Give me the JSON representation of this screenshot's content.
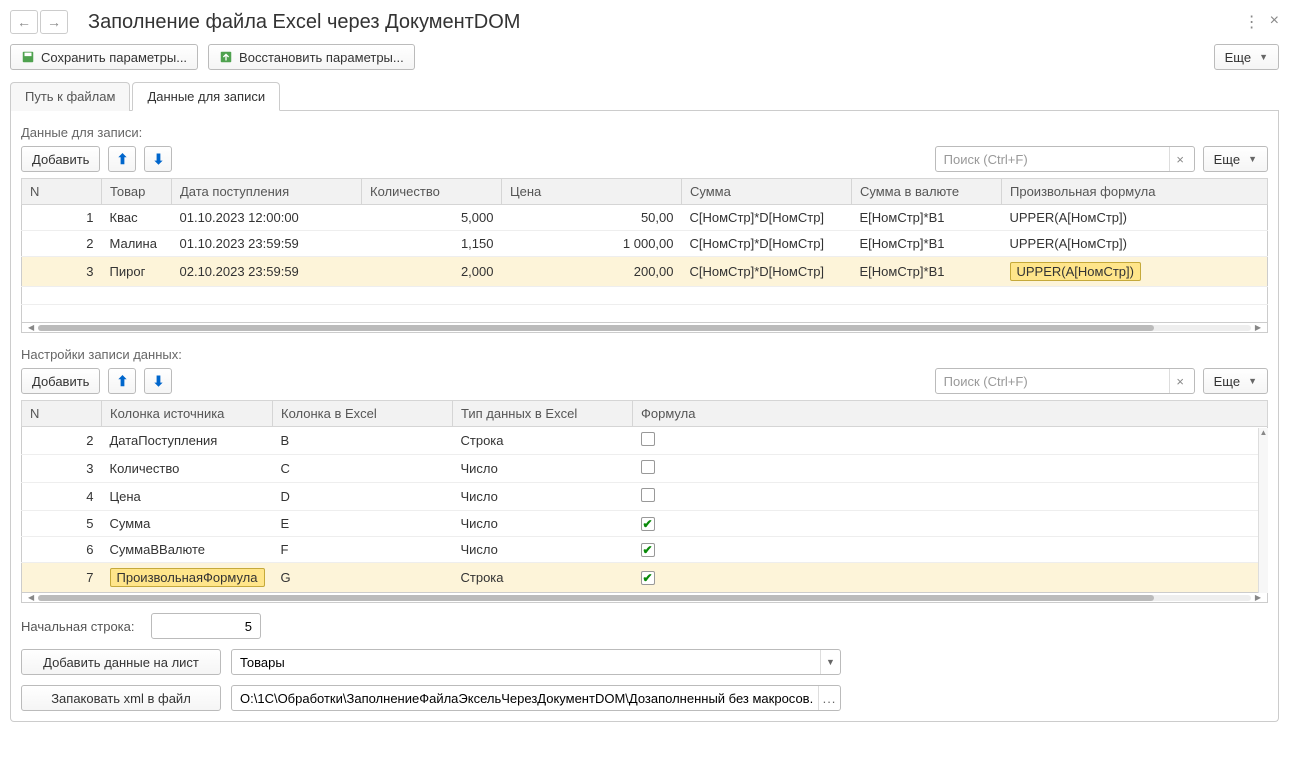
{
  "window": {
    "title": "Заполнение файла Excel через ДокументDOM"
  },
  "toolbar": {
    "save_params": "Сохранить параметры...",
    "restore_params": "Восстановить параметры...",
    "more": "Еще"
  },
  "tabs": {
    "path": "Путь к файлам",
    "data": "Данные для записи"
  },
  "data_section": {
    "label": "Данные для записи:",
    "add": "Добавить",
    "more": "Еще",
    "search_placeholder": "Поиск (Ctrl+F)",
    "columns": {
      "n": "N",
      "product": "Товар",
      "date": "Дата поступления",
      "qty": "Количество",
      "price": "Цена",
      "sum": "Сумма",
      "sum_cur": "Сумма в валюте",
      "formula": "Произвольная формула"
    },
    "rows": [
      {
        "n": "1",
        "product": "Квас",
        "date": "01.10.2023 12:00:00",
        "qty": "5,000",
        "price": "50,00",
        "sum": "C[НомСтр]*D[НомСтр]",
        "sum_cur": "E[НомСтр]*B1",
        "formula": "UPPER(A[НомСтр])"
      },
      {
        "n": "2",
        "product": "Малина",
        "date": "01.10.2023 23:59:59",
        "qty": "1,150",
        "price": "1 000,00",
        "sum": "C[НомСтр]*D[НомСтр]",
        "sum_cur": "E[НомСтр]*B1",
        "formula": "UPPER(A[НомСтр])"
      },
      {
        "n": "3",
        "product": "Пирог",
        "date": "02.10.2023 23:59:59",
        "qty": "2,000",
        "price": "200,00",
        "sum": "C[НомСтр]*D[НомСтр]",
        "sum_cur": "E[НомСтр]*B1",
        "formula": "UPPER(A[НомСтр])"
      }
    ]
  },
  "settings_section": {
    "label": "Настройки записи данных:",
    "add": "Добавить",
    "more": "Еще",
    "search_placeholder": "Поиск (Ctrl+F)",
    "columns": {
      "n": "N",
      "src": "Колонка источника",
      "excel": "Колонка в Excel",
      "type": "Тип данных в Excel",
      "formula": "Формула"
    },
    "rows": [
      {
        "n": "2",
        "src": "ДатаПоступления",
        "excel": "B",
        "type": "Строка",
        "formula": false
      },
      {
        "n": "3",
        "src": "Количество",
        "excel": "C",
        "type": "Число",
        "formula": false
      },
      {
        "n": "4",
        "src": "Цена",
        "excel": "D",
        "type": "Число",
        "formula": false
      },
      {
        "n": "5",
        "src": "Сумма",
        "excel": "E",
        "type": "Число",
        "formula": true
      },
      {
        "n": "6",
        "src": "СуммаВВалюте",
        "excel": "F",
        "type": "Число",
        "formula": true
      },
      {
        "n": "7",
        "src": "ПроизвольнаяФормула",
        "excel": "G",
        "type": "Строка",
        "formula": true
      }
    ]
  },
  "footer": {
    "start_row_label": "Начальная строка:",
    "start_row_value": "5",
    "add_to_sheet": "Добавить данные на лист",
    "sheet_name": "Товары",
    "pack_xml": "Запаковать xml в файл",
    "file_path": "O:\\1С\\Обработки\\ЗаполнениеФайлаЭксельЧерезДокументDOM\\Дозаполненный без макросов..."
  }
}
